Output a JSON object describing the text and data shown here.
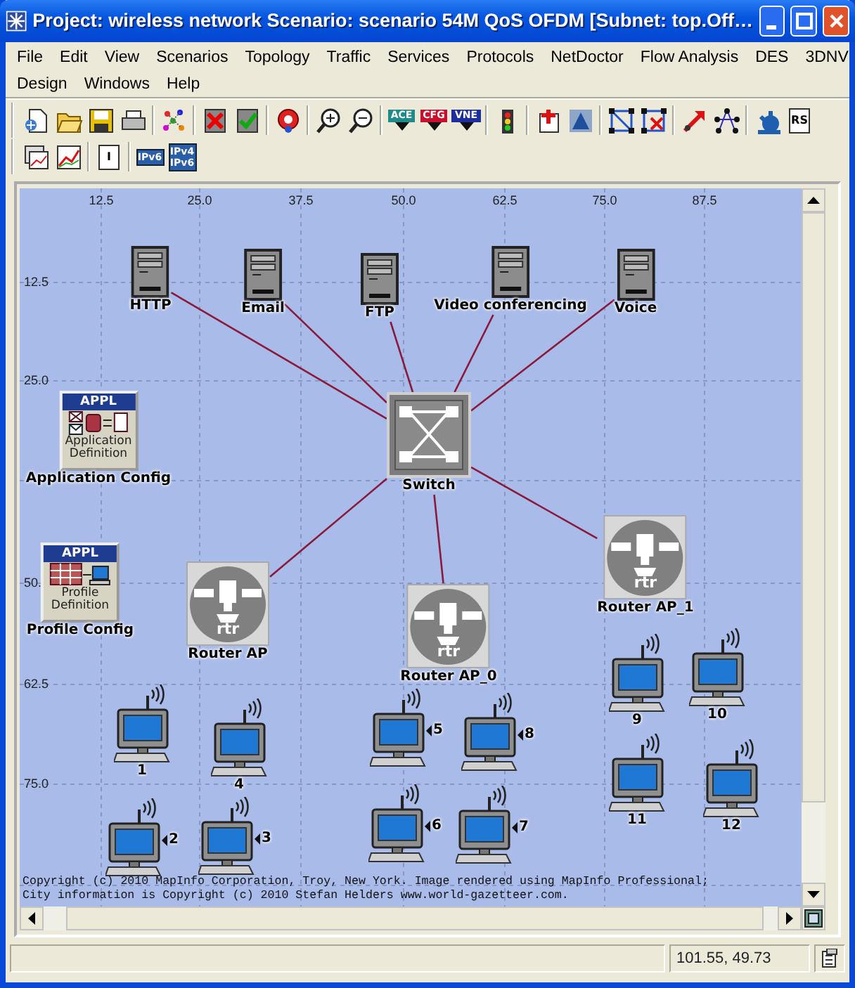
{
  "window": {
    "title": "Project: wireless network Scenario: scenario 54M QoS OFDM  [Subnet: top.Off…"
  },
  "menu_rows": [
    [
      "File",
      "Edit",
      "View",
      "Scenarios",
      "Topology",
      "Traffic",
      "Services",
      "Protocols",
      "NetDoctor",
      "Flow Analysis",
      "DES",
      "3DNV"
    ],
    [
      "Design",
      "Windows",
      "Help"
    ]
  ],
  "toolbars": [
    [
      {
        "kind": "new"
      },
      {
        "kind": "open"
      },
      {
        "kind": "save"
      },
      {
        "kind": "print"
      },
      {
        "kind": "sep"
      },
      {
        "kind": "palette"
      },
      {
        "kind": "sep"
      },
      {
        "kind": "fail"
      },
      {
        "kind": "recover"
      },
      {
        "kind": "sep"
      },
      {
        "kind": "pin"
      },
      {
        "kind": "sep"
      },
      {
        "kind": "zoomin"
      },
      {
        "kind": "zoomout"
      },
      {
        "kind": "sep"
      },
      {
        "kind": "tag",
        "text": "ACE",
        "color": "#1f8a8a"
      },
      {
        "kind": "tag",
        "text": "CFG",
        "color": "#c8102e"
      },
      {
        "kind": "tag",
        "text": "VNE",
        "color": "#1c2f9c"
      },
      {
        "kind": "sep"
      },
      {
        "kind": "traffic"
      },
      {
        "kind": "sep"
      },
      {
        "kind": "redcross"
      },
      {
        "kind": "triangle"
      },
      {
        "kind": "sep"
      },
      {
        "kind": "graph"
      },
      {
        "kind": "graphx"
      },
      {
        "kind": "sep"
      },
      {
        "kind": "arrow"
      },
      {
        "kind": "star"
      },
      {
        "kind": "sep"
      },
      {
        "kind": "gear"
      },
      {
        "kind": "doc",
        "text": "RS"
      }
    ],
    [
      {
        "kind": "windows"
      },
      {
        "kind": "chart"
      },
      {
        "kind": "sep"
      },
      {
        "kind": "doc",
        "text": "I"
      },
      {
        "kind": "sep"
      },
      {
        "kind": "ip",
        "text": "IPv6"
      },
      {
        "kind": "ip2",
        "text": "IPv4",
        "text2": "IPv6"
      }
    ]
  ],
  "rulers": {
    "x_ticks": [
      "12.5",
      "25.0",
      "37.5",
      "50.0",
      "62.5",
      "75.0",
      "87.5"
    ],
    "y_ticks": [
      "12.5",
      "25.0",
      "50.",
      "62.5",
      "75.0"
    ]
  },
  "nodes": [
    {
      "kind": "server",
      "label": "HTTP"
    },
    {
      "kind": "server",
      "label": "Email"
    },
    {
      "kind": "server",
      "label": "FTP"
    },
    {
      "kind": "server",
      "label": "Video conferencing"
    },
    {
      "kind": "server",
      "label": "Voice"
    },
    {
      "kind": "application",
      "badge": "APPL",
      "caption": "Application Definition",
      "label": "Application Config"
    },
    {
      "kind": "switch",
      "label": "Switch"
    },
    {
      "kind": "profile",
      "badge": "APPL",
      "caption": "Profile Definition",
      "label": "Profile Config"
    },
    {
      "kind": "router",
      "badge": "rtr",
      "label": "Router AP"
    },
    {
      "kind": "router",
      "badge": "rtr",
      "label": "Router AP_0"
    },
    {
      "kind": "router",
      "badge": "rtr",
      "label": "Router AP_1"
    },
    {
      "kind": "workstation",
      "label": "1"
    },
    {
      "kind": "workstation",
      "label": "2"
    },
    {
      "kind": "workstation",
      "label": "3"
    },
    {
      "kind": "workstation",
      "label": "4"
    },
    {
      "kind": "workstation",
      "label": "5"
    },
    {
      "kind": "workstation",
      "label": "6"
    },
    {
      "kind": "workstation",
      "label": "7"
    },
    {
      "kind": "workstation",
      "label": "8"
    },
    {
      "kind": "workstation",
      "label": "9"
    },
    {
      "kind": "workstation",
      "label": "10"
    },
    {
      "kind": "workstation",
      "label": "11"
    },
    {
      "kind": "workstation",
      "label": "12"
    }
  ],
  "copyright": [
    "Copyright (c) 2010 MapInfo Corporation, Troy, New York. Image rendered using MapInfo Professional;",
    "City information is Copyright (c) 2010 Stefan Helders www.world-gazetteer.com."
  ],
  "status_bar": {
    "coordinates": "101.55, 49.73"
  }
}
